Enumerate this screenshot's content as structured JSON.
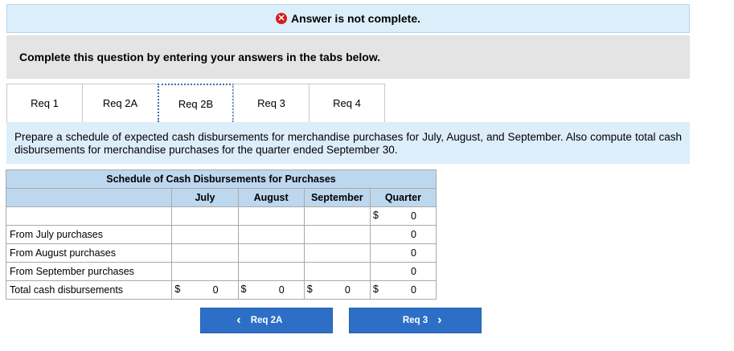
{
  "banner": {
    "icon": "error-x-icon",
    "text": "Answer is not complete."
  },
  "instruction": "Complete this question by entering your answers in the tabs below.",
  "tabs": [
    {
      "label": "Req 1"
    },
    {
      "label": "Req 2A"
    },
    {
      "label": "Req 2B",
      "active": true
    },
    {
      "label": "Req 3"
    },
    {
      "label": "Req 4"
    }
  ],
  "prompt": "Prepare a schedule of expected cash disbursements for merchandise purchases for July, August, and September. Also compute total cash disbursements for merchandise purchases for the quarter ended September 30.",
  "schedule": {
    "title": "Schedule of Cash Disbursements for Purchases",
    "columns": [
      "July",
      "August",
      "September",
      "Quarter"
    ],
    "rows": [
      {
        "label": "",
        "values": [
          "",
          "",
          "",
          "0"
        ],
        "dollar": [
          false,
          false,
          false,
          true
        ]
      },
      {
        "label": "From July purchases",
        "values": [
          "",
          "",
          "",
          "0"
        ]
      },
      {
        "label": "From August purchases",
        "values": [
          "",
          "",
          "",
          "0"
        ]
      },
      {
        "label": "From September purchases",
        "values": [
          "",
          "",
          "",
          "0"
        ]
      },
      {
        "label": "Total cash disbursements",
        "values": [
          "0",
          "0",
          "0",
          "0"
        ],
        "dollar": [
          true,
          true,
          true,
          true
        ]
      }
    ],
    "currency": "$"
  },
  "nav": {
    "prev_label": "Req 2A",
    "next_label": "Req 3"
  },
  "colors": {
    "accent": "#2d6fc7",
    "banner_bg": "#ddeefb",
    "header_bg": "#bdd7ee",
    "error": "#d51d1d"
  }
}
